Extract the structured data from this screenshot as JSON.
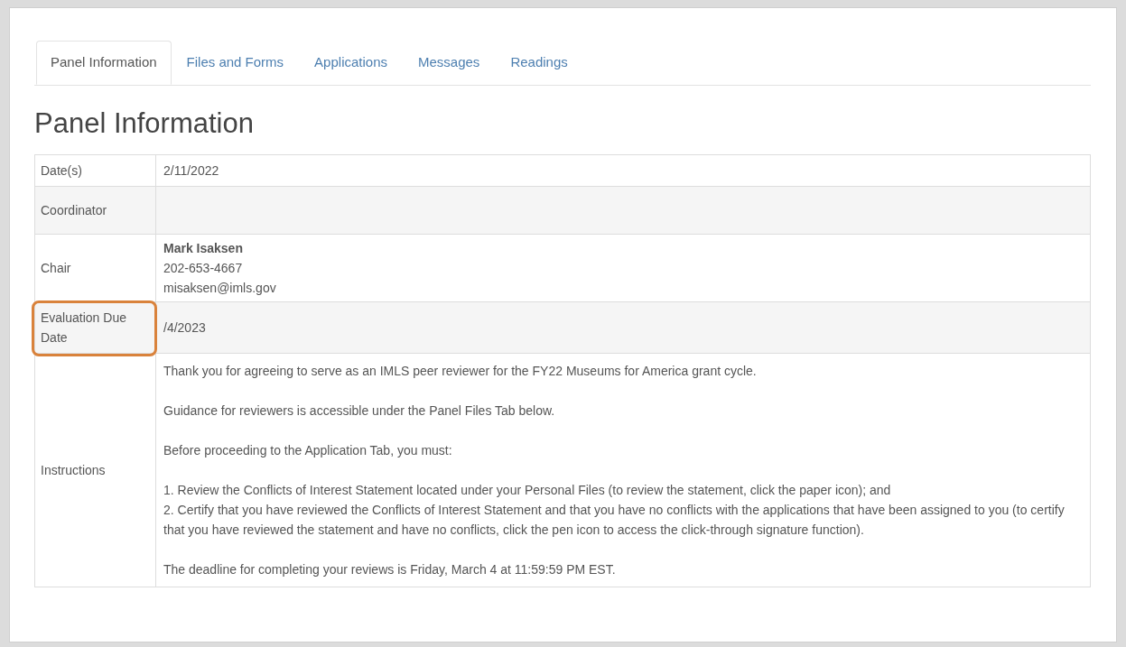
{
  "tabs": [
    {
      "label": "Panel Information",
      "selected": true
    },
    {
      "label": "Files and Forms",
      "selected": false
    },
    {
      "label": "Applications",
      "selected": false
    },
    {
      "label": "Messages",
      "selected": false
    },
    {
      "label": "Readings",
      "selected": false
    }
  ],
  "heading": "Panel Information",
  "table": {
    "rows": [
      {
        "label": "Date(s)",
        "kind": "text",
        "highlighted": false,
        "value": "2/11/2022"
      },
      {
        "label": "Coordinator",
        "kind": "text",
        "highlighted": false
      },
      {
        "label": "Chair",
        "kind": "contact",
        "highlighted": false,
        "name": "Mark Isaksen",
        "phone": "202-653-4667",
        "email": "misaksen@imls.gov"
      },
      {
        "label": "Evaluation Due Date",
        "kind": "text",
        "highlighted": true,
        "value": "/4/2023"
      },
      {
        "label": "Instructions",
        "kind": "paragraphs",
        "highlighted": false,
        "paragraphs": [
          [
            "Thank you for agreeing to serve as an IMLS peer reviewer for the FY22 Museums for America grant cycle."
          ],
          [
            "Guidance for reviewers is accessible under the Panel Files Tab below."
          ],
          [
            "Before proceeding to the Application Tab, you must:"
          ],
          [
            "1. Review the Conflicts of Interest Statement located under your Personal Files (to review the statement, click the paper icon); and",
            "2. Certify that you have reviewed the Conflicts of Interest Statement and that you have no conflicts with the applications that have been assigned to you (to certify that you have reviewed the statement and have no conflicts, click the pen icon to access the click-through signature function)."
          ],
          [
            "The deadline for completing your reviews is Friday, March 4 at 11:59:59 PM EST."
          ]
        ]
      }
    ]
  }
}
